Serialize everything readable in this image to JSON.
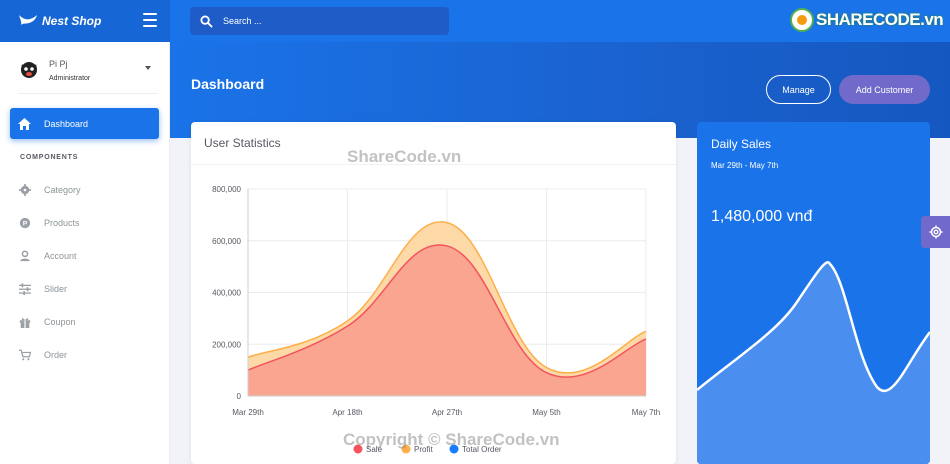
{
  "header": {
    "brand": "Nest Shop",
    "search_placeholder": "Search ...",
    "site_brand": "SHARECODE.vn"
  },
  "sidebar": {
    "user": {
      "name": "Pi Pj",
      "role": "Administrator"
    },
    "active_item": "Dashboard",
    "section_title": "COMPONENTS",
    "items": [
      {
        "label": "Category",
        "icon": "settings-cog-icon"
      },
      {
        "label": "Products",
        "icon": "p-circle-icon"
      },
      {
        "label": "Account",
        "icon": "user-icon"
      },
      {
        "label": "Slider",
        "icon": "sliders-icon"
      },
      {
        "label": "Coupon",
        "icon": "gift-icon"
      },
      {
        "label": "Order",
        "icon": "cart-icon"
      }
    ]
  },
  "panel": {
    "title": "Dashboard",
    "manage_label": "Manage",
    "add_customer_label": "Add Customer"
  },
  "user_statistics": {
    "title": "User Statistics",
    "chart_data": {
      "type": "area",
      "categories": [
        "Mar 29th",
        "Apr 18th",
        "Apr 27th",
        "May 5th",
        "May 7th"
      ],
      "y_ticks": [
        "0",
        "200,000",
        "400,000",
        "600,000",
        "800,000"
      ],
      "ylim": [
        0,
        800000
      ],
      "grid": true,
      "legend_position": "bottom",
      "series": [
        {
          "name": "Sale",
          "color": "#f3545d",
          "values": [
            100000,
            270000,
            580000,
            90000,
            220000
          ]
        },
        {
          "name": "Profit",
          "color": "#fdaf4b",
          "values": [
            150000,
            290000,
            670000,
            110000,
            250000
          ]
        },
        {
          "name": "Total Order",
          "color": "#177dff",
          "values": []
        }
      ]
    }
  },
  "daily_sales": {
    "title": "Daily Sales",
    "date_range": "Mar 29th - May 7th",
    "amount": "1,480,000 vnđ"
  },
  "watermarks": {
    "center": "ShareCode.vn",
    "bottom": "Copyright © ShareCode.vn"
  },
  "colors": {
    "primary": "#1a73e8",
    "secondary": "#716aca"
  }
}
